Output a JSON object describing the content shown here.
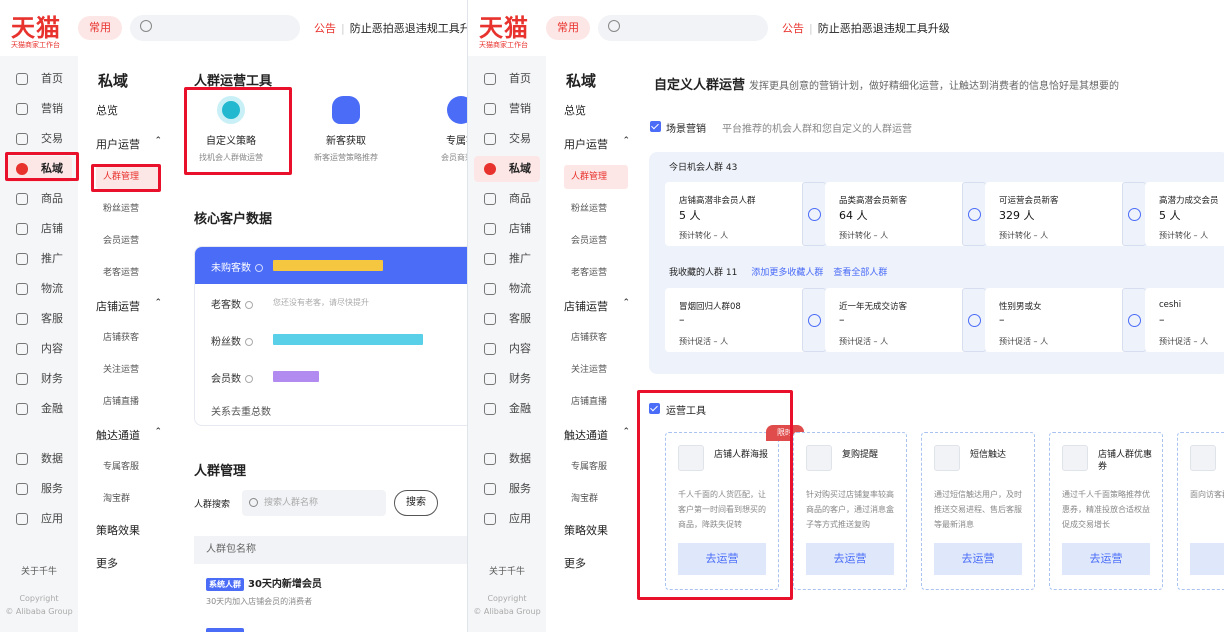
{
  "common": {
    "logo": "天猫",
    "logo_sub": "天猫商家工作台",
    "pill": "常用",
    "announce_label": "公告",
    "announce_text": "防止恶拍恶退违规工具升级",
    "nav": [
      "首页",
      "营销",
      "交易",
      "私域",
      "商品",
      "店铺",
      "推广",
      "物流",
      "客服",
      "内容",
      "财务",
      "金融",
      "数据",
      "服务",
      "应用"
    ],
    "nav_active": "私域",
    "about": "关于千牛",
    "copyright": "Copyright",
    "copyright2": "© Alibaba Group",
    "subnav": {
      "title": "私域",
      "overview": "总览",
      "user_ops": "用户运营",
      "user_items": [
        "人群管理",
        "粉丝运营",
        "会员运营",
        "老客运营"
      ],
      "store_ops": "店铺运营",
      "store_items": [
        "店铺获客",
        "关注运营",
        "店铺直播"
      ],
      "reach": "触达通道",
      "reach_items": [
        "专属客服",
        "淘宝群"
      ],
      "strategy": "策略效果",
      "more": "更多"
    }
  },
  "left": {
    "tools_title": "人群运营工具",
    "tools": [
      {
        "name": "自定义策略",
        "desc": "找机会人群做运营"
      },
      {
        "name": "新客获取",
        "desc": "新客运营策略推荐"
      },
      {
        "name": "专属客",
        "desc": "会员商效触"
      }
    ],
    "core_title": "核心客户数据",
    "rows": [
      {
        "label": "未购客数"
      },
      {
        "label": "老客数",
        "note": "您还没有老客，请尽快提升"
      },
      {
        "label": "粉丝数"
      },
      {
        "label": "会员数"
      }
    ],
    "dedupe": "关系去重总数",
    "mgmt_title": "人群管理",
    "search_label": "人群搜索",
    "search_placeholder": "搜索人群名称",
    "search_btn": "搜索",
    "table_head": "人群包名称",
    "row1_tag": "系统人群",
    "row1_name": "30天内新增会员",
    "row1_desc": "30天内加入店铺会员的消费者"
  },
  "right": {
    "title": "自定义人群运营",
    "subtitle": "发挥更具创意的营销计划，做好精细化运营，让触达到消费者的信息恰好是其想要的",
    "scene_label": "场景营销",
    "scene_desc": "平台推荐的机会人群和您自定义的人群运营",
    "today_label": "今日机会人群 43",
    "today": [
      {
        "name": "店铺高潜非会员人群",
        "value": "5 人",
        "pred": "预计转化 – 人"
      },
      {
        "name": "品类高潜会员新客",
        "value": "64 人",
        "pred": "预计转化 – 人"
      },
      {
        "name": "可运营会员新客",
        "value": "329 人",
        "pred": "预计转化 – 人"
      },
      {
        "name": "高潜力成交会员",
        "value": "5 人",
        "pred": "预计转化 – 人"
      }
    ],
    "fav_label": "我收藏的人群 11",
    "fav_add": "添加更多收藏人群",
    "fav_all": "查看全部人群",
    "fav": [
      {
        "name": "冒烟回归人群08",
        "value": "–",
        "pred": "预计促活 – 人"
      },
      {
        "name": "近一年无成交访客",
        "value": "–",
        "pred": "预计促活 – 人"
      },
      {
        "name": "性别男或女",
        "value": "–",
        "pred": "预计促活 – 人"
      },
      {
        "name": "ceshi",
        "value": "–",
        "pred": "预计促活 – 人"
      }
    ],
    "ops_label": "运营工具",
    "ops": [
      {
        "name": "店铺人群海报",
        "desc": "千人千面的人货匹配，让客户第一时间看到想买的商品，降跌失促转",
        "btn": "去运营",
        "tag": "限时"
      },
      {
        "name": "复购提醒",
        "desc": "针对购买过店铺复率较高商品的客户，通过消息盒子等方式推送复购",
        "btn": "去运营"
      },
      {
        "name": "短信触达",
        "desc": "通过短信触达用户，及时推送交易进程、售后客服等最新消息",
        "btn": "去运营"
      },
      {
        "name": "店铺人群优惠券",
        "desc": "通过千人千面策略推荐优惠券，精准投放合适权益促成交易增长",
        "btn": "去运营"
      },
      {
        "name": "",
        "desc": "面向访客群放权益提升化",
        "btn": "去"
      }
    ]
  }
}
